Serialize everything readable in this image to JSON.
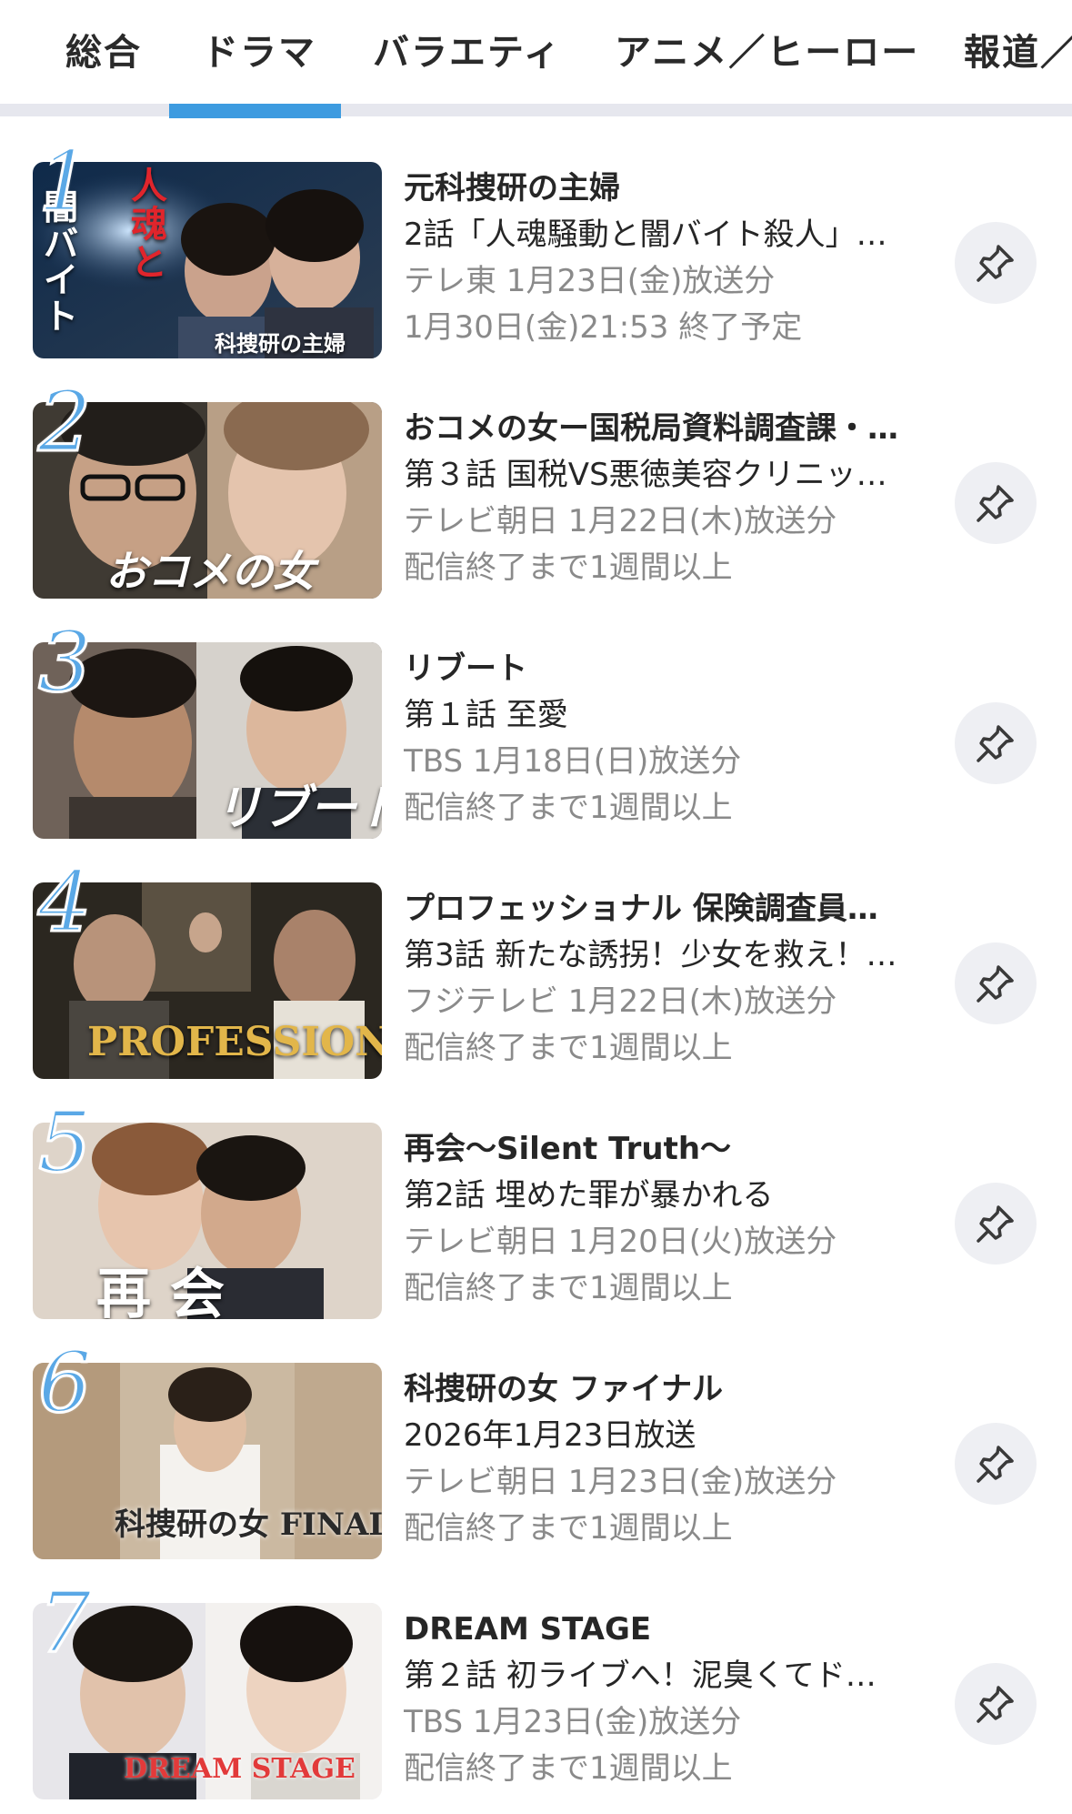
{
  "tabs": [
    {
      "label": "総合"
    },
    {
      "label": "ドラマ"
    },
    {
      "label": "バラエティ"
    },
    {
      "label": "アニメ／ヒーロー"
    },
    {
      "label": "報道／"
    }
  ],
  "selected_tab": "ドラマ",
  "accent_color": "#3d9be0",
  "rank_color": "#5aa8e6",
  "items": [
    {
      "rank": "1",
      "title": "元科捜研の主婦",
      "episode": "2話「人魂騒動と闇バイト殺人」…",
      "broadcast": "テレ東 1月23日(金)放送分",
      "expire": "1月30日(金)21:53 終了予定",
      "thumb_text": "人魂と闇バイト　元科捜研の主婦",
      "pin_icon": "pin-icon"
    },
    {
      "rank": "2",
      "title": "おコメの女ー国税局資料調査課・…",
      "episode": "第３話 国税VS悪徳美容クリニッ…",
      "broadcast": "テレビ朝日 1月22日(木)放送分",
      "expire": "配信終了まで1週間以上",
      "thumb_text": "おコメの女",
      "pin_icon": "pin-icon"
    },
    {
      "rank": "3",
      "title": "リブート",
      "episode": "第１話 至愛",
      "broadcast": "TBS 1月18日(日)放送分",
      "expire": "配信終了まで1週間以上",
      "thumb_text": "リブート",
      "pin_icon": "pin-icon"
    },
    {
      "rank": "4",
      "title": "プロフェッショナル 保険調査員…",
      "episode": "第3話 新たな誘拐！少女を救え！…",
      "broadcast": "フジテレビ 1月22日(木)放送分",
      "expire": "配信終了まで1週間以上",
      "thumb_text": "PROFESSIONAL",
      "pin_icon": "pin-icon"
    },
    {
      "rank": "5",
      "title": "再会〜Silent Truth〜",
      "episode": "第2話 埋めた罪が暴かれる",
      "broadcast": "テレビ朝日 1月20日(火)放送分",
      "expire": "配信終了まで1週間以上",
      "thumb_text": "再 会",
      "pin_icon": "pin-icon"
    },
    {
      "rank": "6",
      "title": "科捜研の女 ファイナル",
      "episode": "2026年1月23日放送",
      "broadcast": "テレビ朝日 1月23日(金)放送分",
      "expire": "配信終了まで1週間以上",
      "thumb_text": "科捜研の女 FINAL",
      "pin_icon": "pin-icon"
    },
    {
      "rank": "7",
      "title": "DREAM STAGE",
      "episode": "第２話 初ライブへ！泥臭くてド…",
      "broadcast": "TBS 1月23日(金)放送分",
      "expire": "配信終了まで1週間以上",
      "thumb_text": "DREAM STAGE",
      "pin_icon": "pin-icon"
    }
  ]
}
